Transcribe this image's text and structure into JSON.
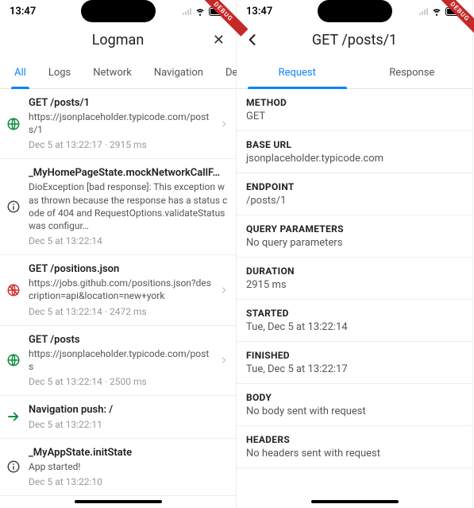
{
  "status": {
    "time": "13:47"
  },
  "debug_label": "DEBUG",
  "left": {
    "title": "Logman",
    "close_glyph": "✕",
    "tabs": [
      "All",
      "Logs",
      "Network",
      "Navigation",
      "Debug"
    ],
    "active_tab_index": 0,
    "rows": [
      {
        "icon": "globe-green",
        "title": "GET /posts/1",
        "sub": "https://jsonplaceholder.typicode.com/posts/1",
        "meta": "Dec 5 at 13:22:17 · 2915 ms",
        "chevron": true
      },
      {
        "icon": "info",
        "title": "_MyHomePageState.mockNetworkCallF…",
        "sub": "DioException [bad response]: This exception was thrown because the response has a status code of 404 and RequestOptions.validateStatus was configur…",
        "meta": "Dec 5 at 13:22:14",
        "chevron": false
      },
      {
        "icon": "globe-red",
        "title": "GET /positions.json",
        "sub": "https://jobs.github.com/positions.json?description=api&location=new+york",
        "meta": "Dec 5 at 13:22:14 · 2472 ms",
        "chevron": true
      },
      {
        "icon": "globe-green",
        "title": "GET /posts",
        "sub": "https://jsonplaceholder.typicode.com/posts",
        "meta": "Dec 5 at 13:22:14 · 2500 ms",
        "chevron": true
      },
      {
        "icon": "arrow-right-green",
        "title": "Navigation push: /",
        "sub": "",
        "meta": "Dec 5 at 13:22:11",
        "chevron": false
      },
      {
        "icon": "info",
        "title": "_MyAppState.initState",
        "sub": "App started!",
        "meta": "Dec 5 at 13:22:10",
        "chevron": false
      }
    ]
  },
  "right": {
    "title": "GET /posts/1",
    "tabs": [
      "Request",
      "Response"
    ],
    "active_tab_index": 0,
    "sections": [
      {
        "label": "METHOD",
        "value": "GET"
      },
      {
        "label": "BASE URL",
        "value": "jsonplaceholder.typicode.com"
      },
      {
        "label": "ENDPOINT",
        "value": "/posts/1"
      },
      {
        "label": "QUERY PARAMETERS",
        "value": "No query parameters"
      },
      {
        "label": "DURATION",
        "value": "2915 ms"
      },
      {
        "label": "STARTED",
        "value": "Tue, Dec 5 at 13:22:14"
      },
      {
        "label": "FINISHED",
        "value": "Tue, Dec 5 at 13:22:17"
      },
      {
        "label": "BODY",
        "value": "No body sent with request"
      },
      {
        "label": "HEADERS",
        "value": "No headers sent with request"
      }
    ]
  }
}
